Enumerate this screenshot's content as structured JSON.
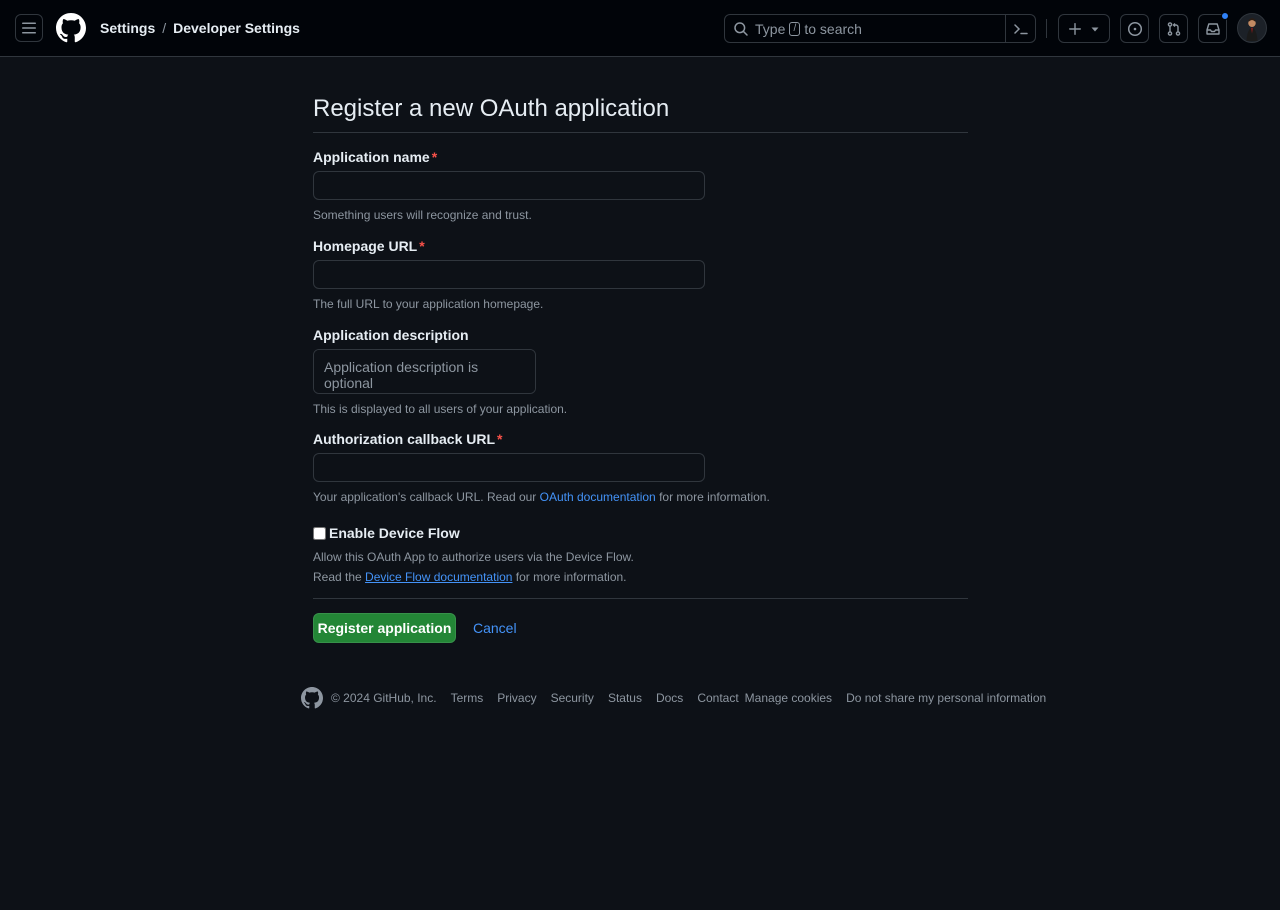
{
  "header": {
    "breadcrumbs": [
      {
        "label": "Settings"
      },
      {
        "label": "Developer Settings"
      }
    ],
    "breadcrumb_separator": "/",
    "search": {
      "prefix": "Type",
      "key": "/",
      "suffix": "to search"
    }
  },
  "page": {
    "title": "Register a new OAuth application"
  },
  "form": {
    "app_name": {
      "label": "Application name",
      "required_mark": "*",
      "value": "",
      "hint": "Something users will recognize and trust."
    },
    "homepage_url": {
      "label": "Homepage URL",
      "required_mark": "*",
      "value": "",
      "hint": "The full URL to your application homepage."
    },
    "description": {
      "label": "Application description",
      "placeholder": "Application description is optional",
      "hint": "This is displayed to all users of your application."
    },
    "callback_url": {
      "label": "Authorization callback URL",
      "required_mark": "*",
      "value": "",
      "hint_before": "Your application's callback URL. Read our",
      "hint_link": "OAuth documentation",
      "hint_after": "for more information."
    },
    "device_flow": {
      "label": "Enable Device Flow",
      "checked": false,
      "hint_line1": "Allow this OAuth App to authorize users via the Device Flow.",
      "hint_line2_before": "Read the",
      "hint_line2_link": "Device Flow documentation",
      "hint_line2_after": "for more information."
    },
    "submit_label": "Register application",
    "cancel_label": "Cancel"
  },
  "footer": {
    "copyright": "© 2024 GitHub, Inc.",
    "links": [
      "Terms",
      "Privacy",
      "Security",
      "Status",
      "Docs",
      "Contact",
      "Manage cookies",
      "Do not share my personal information"
    ]
  },
  "colors": {
    "background": "#0d1117",
    "header_bg": "#010409",
    "border": "#30363d",
    "primary_button": "#238636",
    "link": "#4493f8",
    "required": "#f85149",
    "notification_dot": "#2f81f7"
  }
}
